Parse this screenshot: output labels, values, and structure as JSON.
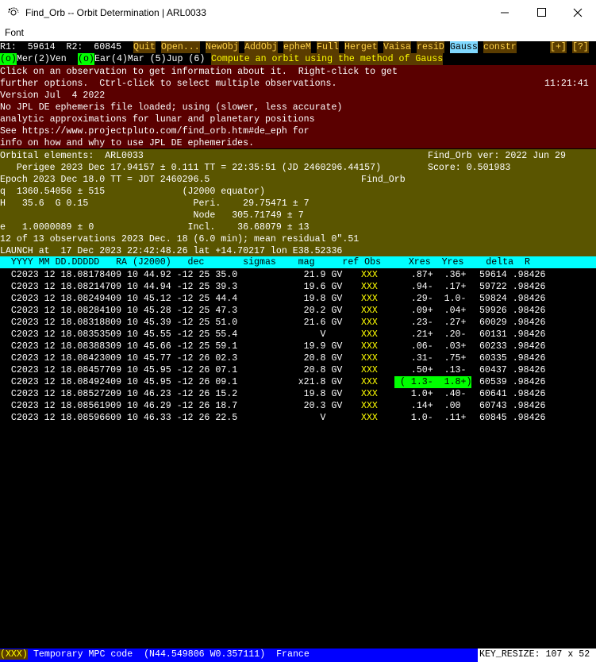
{
  "window": {
    "title": "Find_Orb -- Orbit Determination | ARL0033"
  },
  "menubar": {
    "font_label": "Font"
  },
  "toolbar": {
    "r1": "R1:  59614  R2:  60845",
    "buttons": [
      "Quit",
      "Open...",
      "NewObj",
      "AddObj",
      "epheM",
      "Full",
      "Herget",
      "Vaisa",
      "resiD",
      "Gauss",
      "constr"
    ],
    "right_buttons": [
      "[+]",
      "[?]"
    ]
  },
  "planets": {
    "p1_marker": "(o)",
    "p1_label": "Mer",
    "p2": "(2)Ven",
    "p3_marker": "(o)",
    "p3_label": "Ear",
    "p4": "(4)Mar (5)Jup (6)",
    "tooltip": "Compute an orbit using the method of Gauss"
  },
  "info": {
    "line1": "Click on an observation to get information about it.  Right-click to get",
    "line2": "further options.  Ctrl-click to select multiple observations.",
    "clock": "11:21:41",
    "line3": "Version Jul  4 2022",
    "line4": "No JPL DE ephemeris file loaded; using (slower, less accurate)",
    "line5": "analytic approximations for lunar and planetary positions",
    "line6": "See https://www.projectpluto.com/find_orb.htm#de_eph for",
    "line7": "info on how and why to use JPL DE ephemerides."
  },
  "elements": {
    "l1": "Orbital elements:  ARL0033",
    "l1r": "Find_Orb ver: 2022 Jun 29",
    "l2": "   Perigee 2023 Dec 17.94157 ± 0.111 TT = 22:35:51 (JD 2460296.44157)",
    "l2r": "Score: 0.501983",
    "l3": "Epoch 2023 Dec 18.0 TT = JDT 2460296.5",
    "l3r": "Find_Orb",
    "l4": "q  1360.54056 ± 515              (J2000 equator)",
    "l5": "H   35.6  G 0.15                   Peri.    29.75471 ± 7",
    "l6": "                                   Node   305.71749 ± 7",
    "l7": "e   1.0000089 ± 0                 Incl.    36.68079 ± 13",
    "l8": "12 of 13 observations 2023 Dec. 18 (6.0 min); mean residual 0\".51",
    "l9": "LAUNCH at  17 Dec 2023 22:42:48.26 lat +14.70217 lon E38.52336"
  },
  "table": {
    "header": "  YYYY MM DD.DDDDD   RA (J2000)   dec       sigmas    mag     ref Obs     Xres  Yres    delta  R",
    "rows": [
      {
        "left": "  C2023 12 18.08178409 10 44.92 -12 25 35.0            21.9 GV ",
        "obs": "XXX",
        "res": "   .87+  .36+  ",
        "right": " 59614 .98426",
        "sel": false
      },
      {
        "left": "  C2023 12 18.08214709 10 44.94 -12 25 39.3            19.6 GV ",
        "obs": "XXX",
        "res": "   .94-  .17+  ",
        "right": " 59722 .98426",
        "sel": false
      },
      {
        "left": "  C2023 12 18.08249409 10 45.12 -12 25 44.4            19.8 GV ",
        "obs": "XXX",
        "res": "   .29-  1.0-  ",
        "right": " 59824 .98426",
        "sel": false
      },
      {
        "left": "  C2023 12 18.08284109 10 45.28 -12 25 47.3            20.2 GV ",
        "obs": "XXX",
        "res": "   .09+  .04+  ",
        "right": " 59926 .98426",
        "sel": false
      },
      {
        "left": "  C2023 12 18.08318809 10 45.39 -12 25 51.0            21.6 GV ",
        "obs": "XXX",
        "res": "   .23-  .27+  ",
        "right": " 60029 .98426",
        "sel": false
      },
      {
        "left": "  C2023 12 18.08353509 10 45.55 -12 25 55.4               V    ",
        "obs": "XXX",
        "res": "   .21+  .20-  ",
        "right": " 60131 .98426",
        "sel": false
      },
      {
        "left": "  C2023 12 18.08388309 10 45.66 -12 25 59.1            19.9 GV ",
        "obs": "XXX",
        "res": "   .06-  .03+  ",
        "right": " 60233 .98426",
        "sel": false
      },
      {
        "left": "  C2023 12 18.08423009 10 45.77 -12 26 02.3            20.8 GV ",
        "obs": "XXX",
        "res": "   .31-  .75+  ",
        "right": " 60335 .98426",
        "sel": false
      },
      {
        "left": "  C2023 12 18.08457709 10 45.95 -12 26 07.1            20.8 GV ",
        "obs": "XXX",
        "res": "   .50+  .13-  ",
        "right": " 60437 .98426",
        "sel": false
      },
      {
        "left": "  C2023 12 18.08492409 10 45.95 -12 26 09.1           x21.8 GV ",
        "obs": "XXX",
        "res": " ( 1.3-  1.8+)",
        "right": " 60539 .98426",
        "sel": true
      },
      {
        "left": "  C2023 12 18.08527209 10 46.23 -12 26 15.2            19.8 GV ",
        "obs": "XXX",
        "res": "   1.0+  .40-  ",
        "right": " 60641 .98426",
        "sel": false
      },
      {
        "left": "  C2023 12 18.08561909 10 46.29 -12 26 18.7            20.3 GV ",
        "obs": "XXX",
        "res": "   .14+  .00   ",
        "right": " 60743 .98426",
        "sel": false
      },
      {
        "left": "  C2023 12 18.08596609 10 46.33 -12 26 22.5               V    ",
        "obs": "XXX",
        "res": "   1.0-  .11+  ",
        "right": " 60845 .98426",
        "sel": false
      }
    ]
  },
  "status": {
    "code": "(XXX)",
    "text": " Temporary MPC code  (N44.549806 W0.357111)  France",
    "key": "KEY_RESIZE: 107 x 52"
  },
  "colors": {
    "cyan": "#00ffff",
    "red_band": "#5a0000",
    "olive_band": "#5a5500",
    "status_blue": "#0000ff"
  }
}
